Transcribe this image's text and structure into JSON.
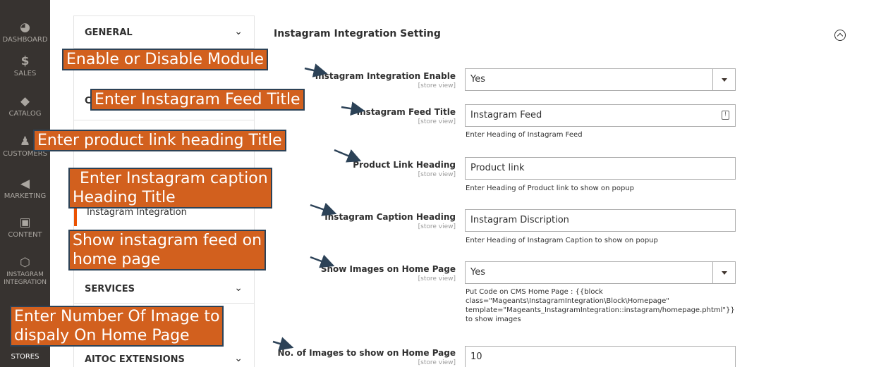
{
  "sidebar": {
    "items": [
      {
        "label": "Dashboard",
        "icon": "gauge-icon"
      },
      {
        "label": "Sales",
        "icon": "dollar-icon"
      },
      {
        "label": "Catalog",
        "icon": "cube-icon"
      },
      {
        "label": "Customers",
        "icon": "person-icon"
      },
      {
        "label": "Marketing",
        "icon": "megaphone-icon"
      },
      {
        "label": "Content",
        "icon": "layout-icon"
      },
      {
        "label": "Instagram Integration",
        "icon": "hexagon-icon"
      },
      {
        "label": "Stores",
        "icon": "store-icon"
      }
    ]
  },
  "tabs": {
    "general": "GENERAL",
    "catalog_partial": "C",
    "sub_item": "Instagram Integration",
    "services": "SERVICES",
    "aitoc": "AITOC EXTENSIONS"
  },
  "section": {
    "title": "Instagram Integration Setting"
  },
  "fields": {
    "enable": {
      "label": "Instagram Integration Enable",
      "scope": "[store view]",
      "value": "Yes"
    },
    "feed_title": {
      "label": "Instagram Feed Title",
      "scope": "[store view]",
      "value": "Instagram Feed",
      "note": "Enter Heading of Instagram Feed"
    },
    "product_link": {
      "label": "Product Link Heading",
      "scope": "[store view]",
      "value": "Product link",
      "note": "Enter Heading of Product link to show on popup"
    },
    "caption": {
      "label": "Instagram Caption Heading",
      "scope": "[store view]",
      "value": "Instagram Discription",
      "note": "Enter Heading of Instagram Caption to show on popup"
    },
    "home_images": {
      "label": "Show Images on Home Page",
      "scope": "[store view]",
      "value": "Yes",
      "note": "Put Code on CMS Home Page : {{block class=\"Mageants\\InstagramIntegration\\Block\\Homepage\" template=\"Mageants_InstagramIntegration::instagram/homepage.phtml\"}} to show images"
    },
    "num_images": {
      "label": "No. of Images to show on Home Page",
      "scope": "[store view]",
      "value": "10"
    }
  },
  "callouts": {
    "c1": "Enable or Disable Module",
    "c2": "Enter Instagram Feed Title",
    "c3": "Enter product link heading Title",
    "c4_line1": "Enter Instagram caption",
    "c4_line2": "Heading Title",
    "c5_line1": "Show instagram feed on",
    "c5_line2": "home page",
    "c6_line1": "Enter Number Of Image to",
    "c6_line2": "dispaly On Home Page"
  },
  "colors": {
    "sidebar_bg": "#373330",
    "callout_bg": "#d2601e",
    "callout_border": "#2c4257",
    "accent": "#eb5202"
  }
}
